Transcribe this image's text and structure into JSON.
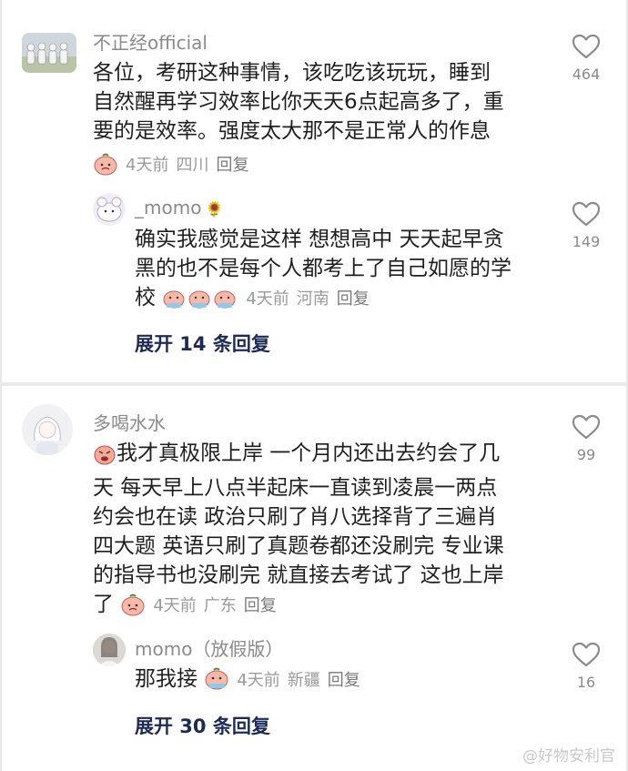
{
  "threads": [
    {
      "comment": {
        "username": "不正经official",
        "lines": [
          "各位，考研这种事情，该吃吃该玩玩，睡到",
          "自然醒再学习效率比你天天6点起高多了，重",
          "要的是效率。强度太大那不是正常人的作息"
        ],
        "time": "4天前",
        "location": "四川",
        "reply": "回复",
        "likes": "464"
      },
      "reply": {
        "username": "_momo",
        "username_emoji": "🌻",
        "lines": [
          "确实我感觉是这样 想想高中 天天起早贪",
          "黑的也不是每个人都考上了自己如愿的学",
          "校"
        ],
        "time": "4天前",
        "location": "河南",
        "reply": "回复",
        "likes": "149"
      },
      "expand": "展开 14 条回复"
    },
    {
      "comment": {
        "username": "多喝水水",
        "lines": [
          "我才真极限上岸 一个月内还出去约会了几",
          "天 每天早上八点半起床一直读到凌晨一两点",
          "约会也在读 政治只刷了肖八选择背了三遍肖",
          "四大题 英语只刷了真题卷都还没刷完 专业课",
          "的指导书也没刷完 就直接去考试了 这也上岸",
          "了"
        ],
        "time": "4天前",
        "location": "广东",
        "reply": "回复",
        "likes": "99"
      },
      "reply": {
        "username": "momo（放假版）",
        "lines": [
          "那我接"
        ],
        "time": "4天前",
        "location": "新疆",
        "reply": "回复",
        "likes": "16"
      },
      "expand": "展开 30 条回复"
    }
  ],
  "watermark": "@好物安利官",
  "icons": {
    "like": "heart-outline-icon",
    "sticker": "peach-face-sticker"
  },
  "colors": {
    "text": "#1f1f1f",
    "meta": "#9a9a9a",
    "expand": "#1c2a55"
  }
}
